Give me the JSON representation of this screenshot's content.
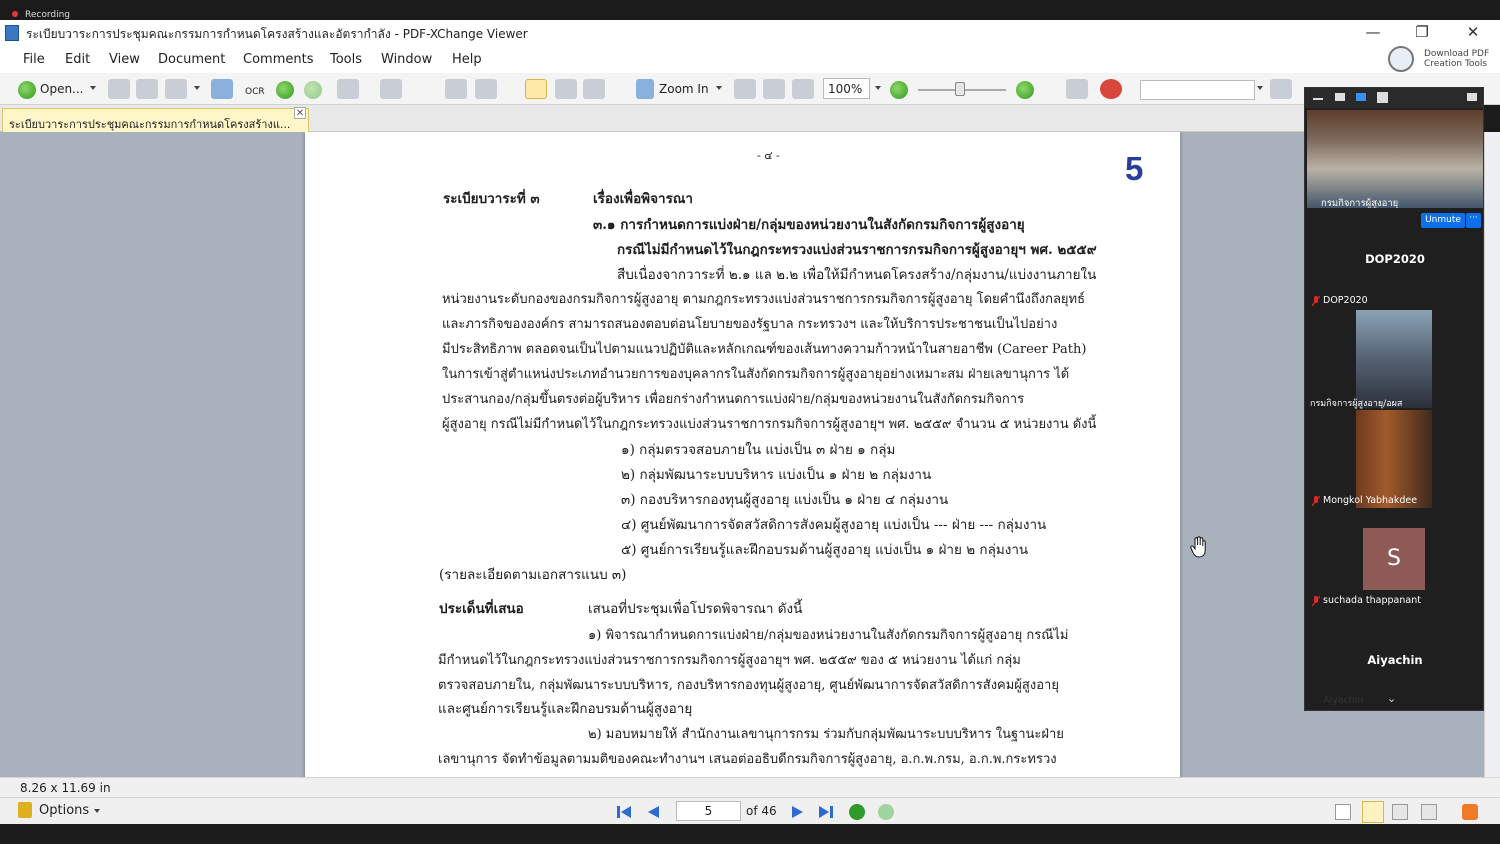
{
  "recording": {
    "label": "Recording"
  },
  "window": {
    "title": "ระเบียบวาระการประชุมคณะกรรมการกำหนดโครงสร้างและอัตรากำลัง - PDF-XChange Viewer",
    "minimize": "—",
    "restore": "❐",
    "close": "✕"
  },
  "menu": [
    "File",
    "Edit",
    "View",
    "Document",
    "Comments",
    "Tools",
    "Window",
    "Help"
  ],
  "download_tools": {
    "line1": "Download PDF",
    "line2": "Creation Tools"
  },
  "toolbar": {
    "open_label": "Open...",
    "ocr_label": "OCR",
    "zoom_in_label": "Zoom In",
    "zoom_value": "100%"
  },
  "tab": {
    "label": "ระเบียบวาระการประชุมคณะกรรมการกำหนดโครงสร้างแ...",
    "close": "✕"
  },
  "document": {
    "header_mark": "- ๔ -",
    "page_badge": "5",
    "lines": [
      "ระเบียบวาระที่ ๓",
      "เรื่องเพื่อพิจารณา",
      "๓.๑ การกำหนดการแบ่งฝ่าย/กลุ่มของหน่วยงานในสังกัดกรมกิจการผู้สูงอายุ",
      "กรณีไม่มีกำหนดไว้ในกฎกระทรวงแบ่งส่วนราชการกรมกิจการผู้สูงอายุฯ พศ. ๒๕๕๙",
      "สืบเนื่องจากวาระที่ ๒.๑ แล ๒.๒ เพื่อให้มีกำหนดโครงสร้าง/กลุ่มงาน/แบ่งงานภายใน",
      "หน่วยงานระดับกองของกรมกิจการผู้สูงอายุ ตามกฎกระทรวงแบ่งส่วนราชการกรมกิจการผู้สูงอายุ โดยคำนึงถึงกลยุทธ์",
      "และภารกิจขององค์กร สามารถสนองตอบต่อนโยบายของรัฐบาล กระทรวงฯ และให้บริการประชาชนเป็นไปอย่าง",
      "มีประสิทธิภาพ ตลอดจนเป็นไปตามแนวปฏิบัติและหลักเกณฑ์ของเส้นทางความก้าวหน้าในสายอาชีพ (Career Path)",
      "ในการเข้าสู่ตำแหน่งประเภทอำนวยการของบุคลากรในสังกัดกรมกิจการผู้สูงอายุอย่างเหมาะสม ฝ่ายเลขานุการ ได้",
      "ประสานกอง/กลุ่มขึ้นตรงต่อผู้บริหาร เพื่อยกร่างกำหนดการแบ่งฝ่าย/กลุ่มของหน่วยงานในสังกัดกรมกิจการ",
      "ผู้สูงอายุ กรณีไม่มีกำหนดไว้ในกฎกระทรวงแบ่งส่วนราชการกรมกิจการผู้สูงอายุฯ พศ. ๒๕๕๙ จำนวน ๕ หน่วยงาน ดังนี้",
      "๑) กลุ่มตรวจสอบภายใน แบ่งเป็น ๓ ฝ่าย ๑ กลุ่ม",
      "๒) กลุ่มพัฒนาระบบบริหาร แบ่งเป็น ๑ ฝ่าย ๒ กลุ่มงาน",
      "๓) กองบริหารกองทุนผู้สูงอายุ แบ่งเป็น ๑ ฝ่าย ๔ กลุ่มงาน",
      "๔) ศูนย์พัฒนาการจัดสวัสดิการสังคมผู้สูงอายุ แบ่งเป็น --- ฝ่าย --- กลุ่มงาน",
      "๕) ศูนย์การเรียนรู้และฝึกอบรมด้านผู้สูงอายุ แบ่งเป็น ๑ ฝ่าย ๒ กลุ่มงาน",
      "(รายละเอียดตามเอกสารแนบ ๓)",
      "ประเด็นที่เสนอ",
      "เสนอที่ประชุมเพื่อโปรดพิจารณา ดังนี้",
      "๑) พิจารณากำหนดการแบ่งฝ่าย/กลุ่มของหน่วยงานในสังกัดกรมกิจการผู้สูงอายุ กรณีไม่",
      "มีกำหนดไว้ในกฎกระทรวงแบ่งส่วนราชการกรมกิจการผู้สูงอายุฯ พศ. ๒๕๕๙ ของ ๕ หน่วยงาน ได้แก่ กลุ่ม",
      "ตรวจสอบภายใน, กลุ่มพัฒนาระบบบริหาร, กองบริหารกองทุนผู้สูงอายุ, ศูนย์พัฒนาการจัดสวัสดิการสังคมผู้สูงอายุ",
      "และศูนย์การเรียนรู้และฝึกอบรมด้านผู้สูงอายุ",
      "๒) มอบหมายให้ สำนักงานเลขานุการกรม ร่วมกับกลุ่มพัฒนาระบบบริหาร ในฐานะฝ่าย",
      "เลขานุการ จัดทำข้อมูลตามมติของคณะทำงานฯ เสนอต่ออธิบดีกรมกิจการผู้สูงอายุ, อ.ก.พ.กรม, อ.ก.พ.กระทรวง"
    ]
  },
  "status": {
    "page_size": "8.26 x 11.69 in"
  },
  "nav": {
    "options_label": "Options",
    "current_page": "5",
    "of_pages": "of 46"
  },
  "zoom_panel": {
    "tile1_label": "กรมกิจการผู้สูงอายุ",
    "unmute_label": "Unmute",
    "more_label": "···",
    "name1": "DOP2020",
    "tile2_label": "DOP2020",
    "tile3_label": "กรมกิจการผู้สูงอายุ/อผส",
    "tile4_label": "Mongkol Yabhakdee",
    "avatar_letter": "S",
    "tile5_label": "suchada thappanant",
    "name2": "Aiyachin",
    "tile6_label": "Aiyachin",
    "chevron": "⌄"
  }
}
